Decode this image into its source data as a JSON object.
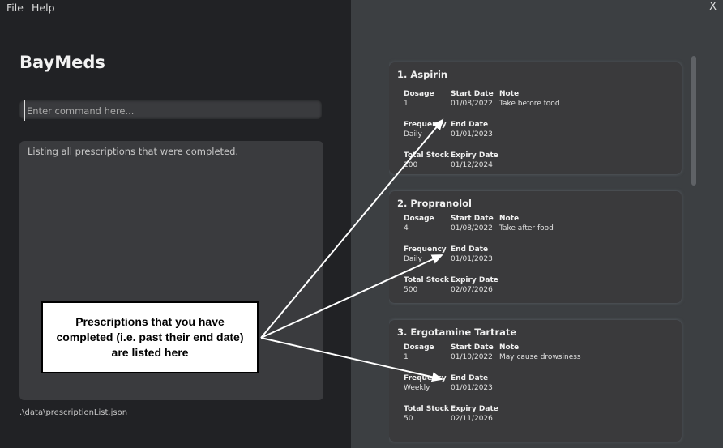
{
  "menu": {
    "file_label": "File",
    "help_label": "Help",
    "close_label": "X"
  },
  "app": {
    "title": "BayMeds",
    "command_placeholder": "Enter command here...",
    "result_message": "Listing all prescriptions that were completed.",
    "status_path": ".\\data\\prescriptionList.json"
  },
  "labels": {
    "dosage": "Dosage",
    "start_date": "Start Date",
    "note": "Note",
    "frequency": "Frequency",
    "end_date": "End Date",
    "total_stock": "Total Stock",
    "expiry_date": "Expiry Date"
  },
  "prescriptions": [
    {
      "title": "1.  Aspirin",
      "dosage": "1",
      "start_date": "01/08/2022",
      "note": "Take before food",
      "frequency": "Daily",
      "end_date": "01/01/2023",
      "total_stock": "100",
      "expiry_date": "01/12/2024"
    },
    {
      "title": "2.  Propranolol",
      "dosage": "4",
      "start_date": "01/08/2022",
      "note": "Take after food",
      "frequency": "Daily",
      "end_date": "01/01/2023",
      "total_stock": "500",
      "expiry_date": "02/07/2026"
    },
    {
      "title": "3.  Ergotamine Tartrate",
      "dosage": "1",
      "start_date": "01/10/2022",
      "note": "May cause drowsiness",
      "frequency": "Weekly",
      "end_date": "01/01/2023",
      "total_stock": "50",
      "expiry_date": "02/11/2026"
    }
  ],
  "callout": {
    "text": "Prescriptions that you have completed (i.e. past their end date) are listed here"
  }
}
